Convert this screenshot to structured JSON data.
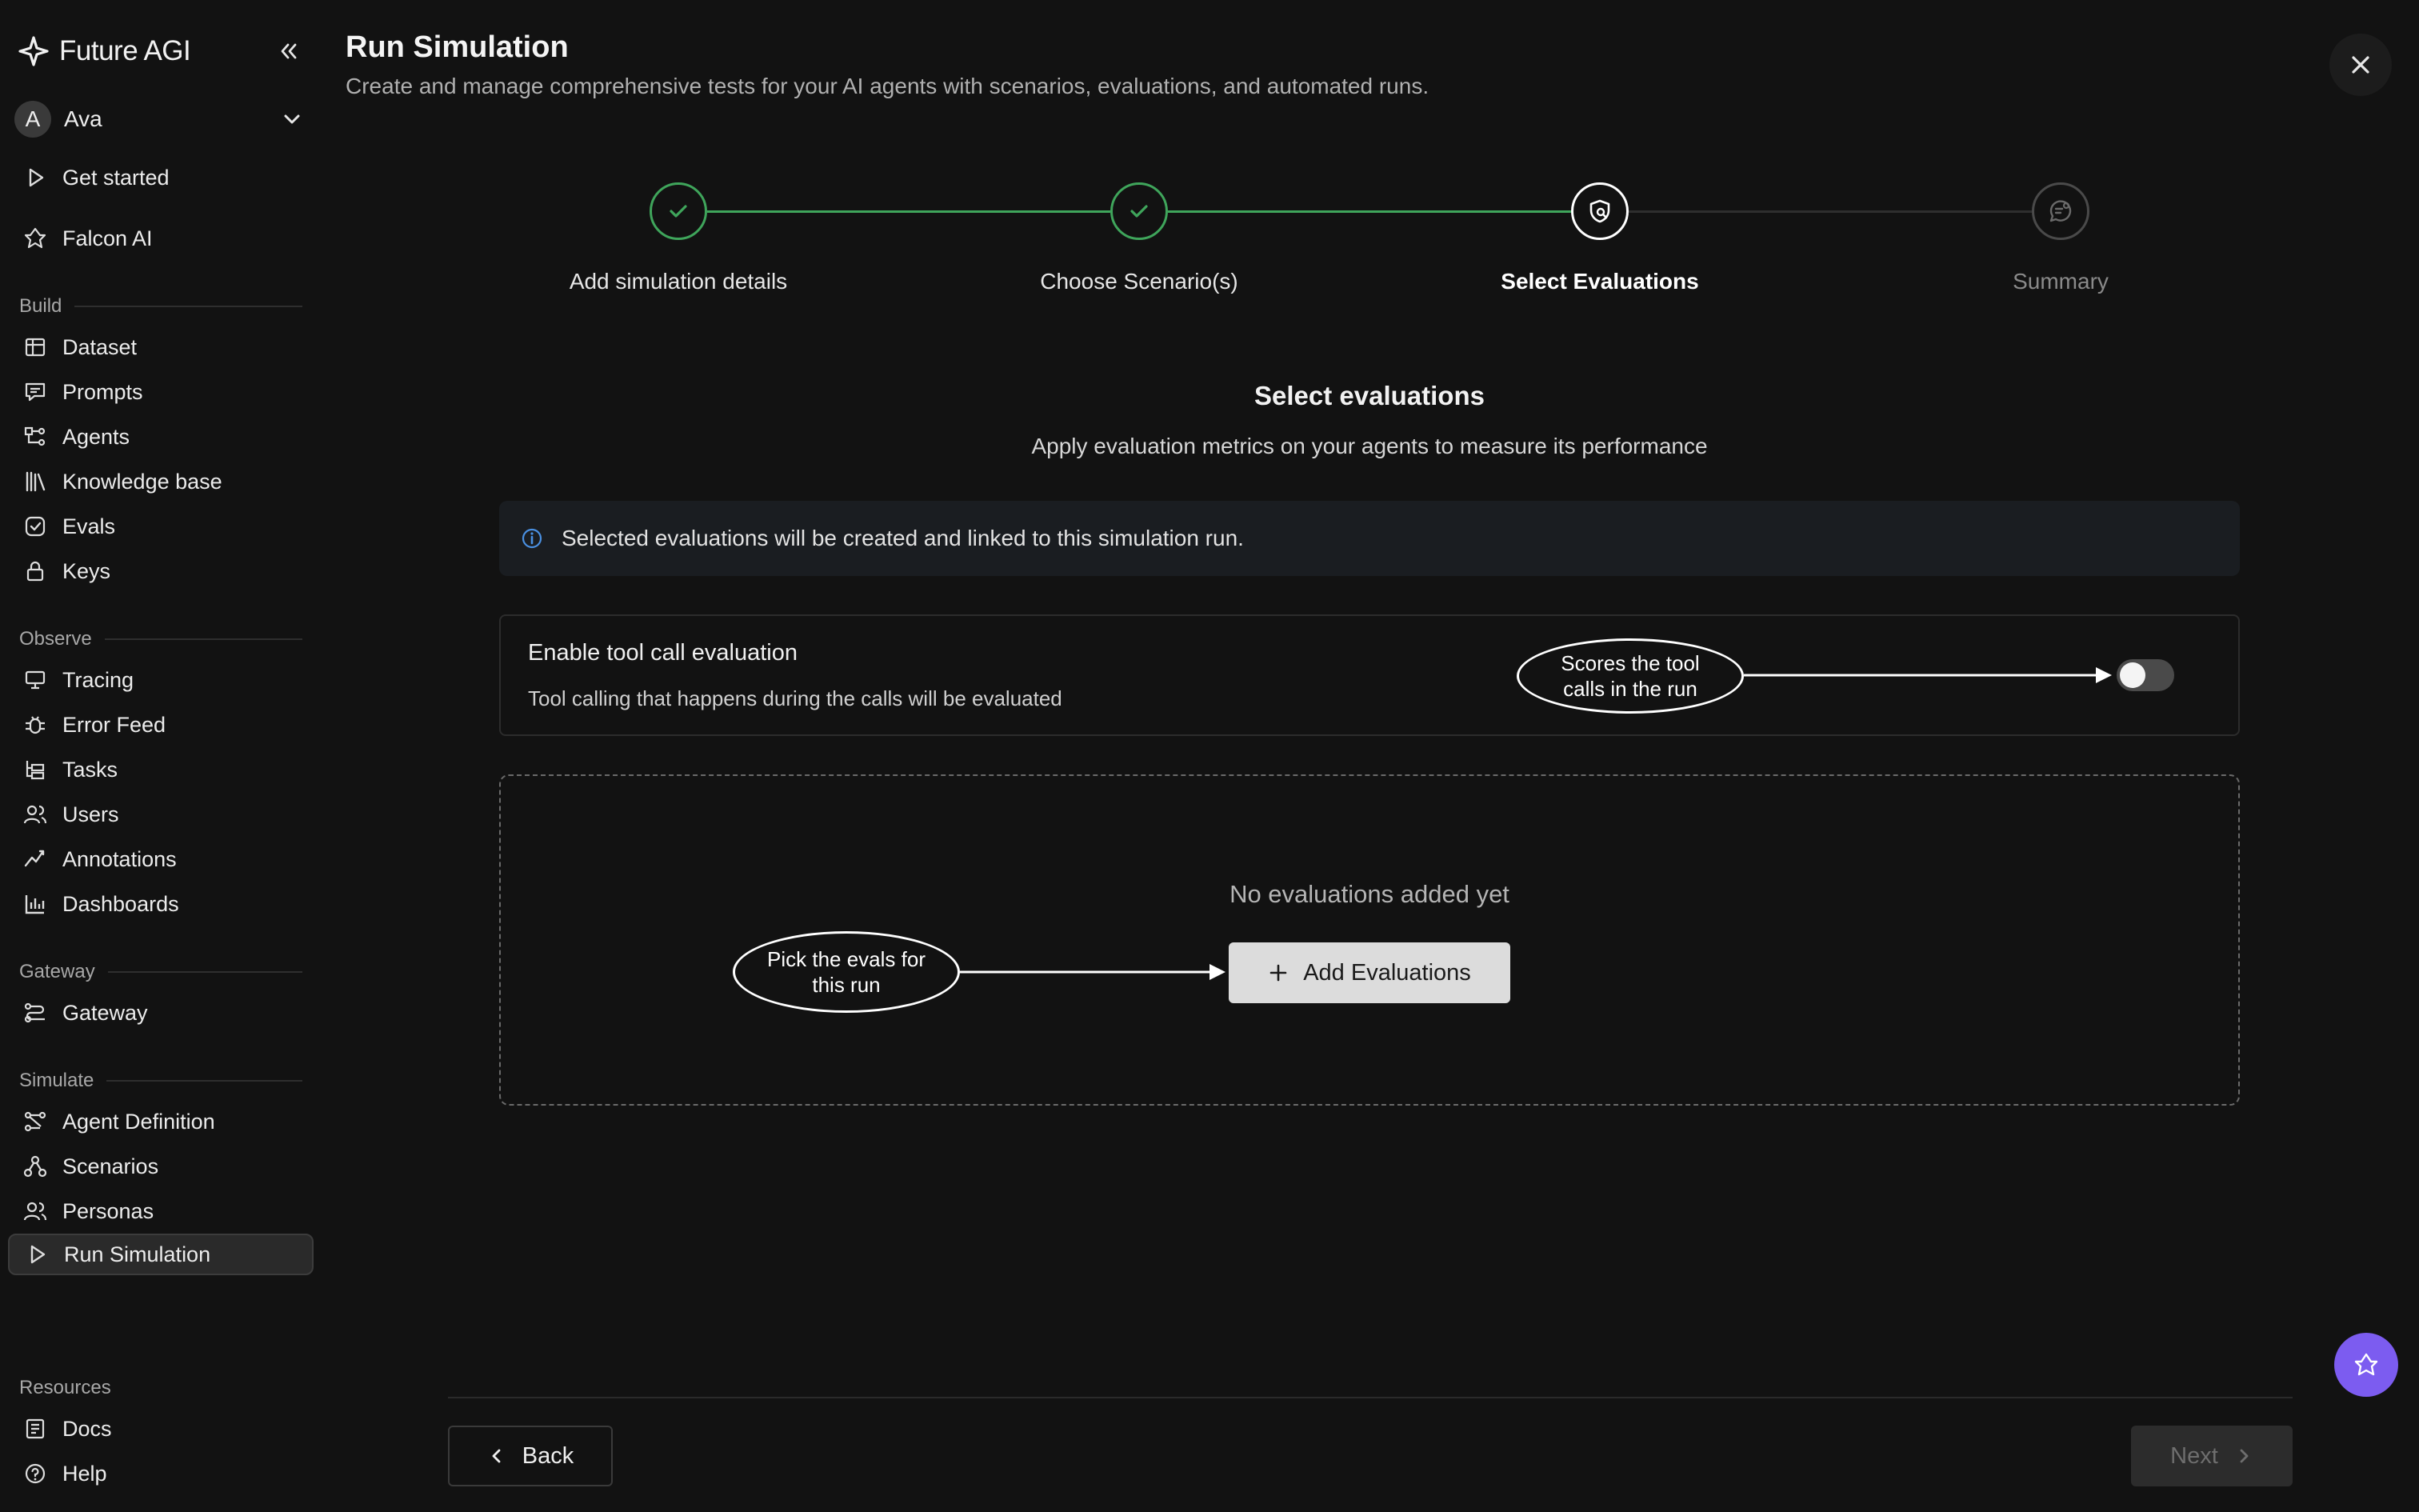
{
  "app": {
    "name": "Future AGI"
  },
  "user": {
    "initial": "A",
    "name": "Ava"
  },
  "sidebar": {
    "top_items": [
      {
        "label": "Get started",
        "icon": "play-icon"
      },
      {
        "label": "Falcon AI",
        "icon": "falcon-icon"
      }
    ],
    "sections": [
      {
        "label": "Build",
        "items": [
          {
            "label": "Dataset",
            "icon": "table-icon"
          },
          {
            "label": "Prompts",
            "icon": "prompt-icon"
          },
          {
            "label": "Agents",
            "icon": "agents-icon"
          },
          {
            "label": "Knowledge base",
            "icon": "library-icon"
          },
          {
            "label": "Evals",
            "icon": "check-circle-icon"
          },
          {
            "label": "Keys",
            "icon": "lock-icon"
          }
        ]
      },
      {
        "label": "Observe",
        "items": [
          {
            "label": "Tracing",
            "icon": "monitor-icon"
          },
          {
            "label": "Error Feed",
            "icon": "bug-icon"
          },
          {
            "label": "Tasks",
            "icon": "tasks-icon"
          },
          {
            "label": "Users",
            "icon": "users-icon"
          },
          {
            "label": "Annotations",
            "icon": "annotate-icon"
          },
          {
            "label": "Dashboards",
            "icon": "bar-chart-icon"
          }
        ]
      },
      {
        "label": "Gateway",
        "items": [
          {
            "label": "Gateway",
            "icon": "gateway-icon"
          }
        ]
      },
      {
        "label": "Simulate",
        "items": [
          {
            "label": "Agent Definition",
            "icon": "workflow-icon"
          },
          {
            "label": "Scenarios",
            "icon": "scenario-icon"
          },
          {
            "label": "Personas",
            "icon": "personas-icon"
          },
          {
            "label": "Run Simulation",
            "icon": "play-icon",
            "active": true
          }
        ]
      },
      {
        "label": "Resources",
        "items": [
          {
            "label": "Docs",
            "icon": "docs-icon"
          },
          {
            "label": "Help",
            "icon": "help-icon"
          }
        ]
      }
    ]
  },
  "header": {
    "title": "Run Simulation",
    "subtitle": "Create and manage comprehensive tests for your AI agents with scenarios, evaluations, and automated runs."
  },
  "stepper": {
    "steps": [
      {
        "label": "Add simulation details",
        "state": "done"
      },
      {
        "label": "Choose Scenario(s)",
        "state": "done"
      },
      {
        "label": "Select Evaluations",
        "state": "current"
      },
      {
        "label": "Summary",
        "state": "upcoming"
      }
    ],
    "colors": {
      "done": "#3fa55b",
      "current": "#ffffff",
      "upcoming": "#6a6a6a"
    }
  },
  "main": {
    "title": "Select evaluations",
    "description": "Apply evaluation metrics on your agents to measure its performance",
    "info_banner": "Selected evaluations will be created and linked to this simulation run.",
    "tool_call": {
      "title": "Enable tool call evaluation",
      "description": "Tool calling that happens during the calls will be evaluated",
      "enabled": false
    },
    "empty_state": "No evaluations added yet",
    "add_button": "Add Evaluations"
  },
  "callouts": {
    "toggle": "Scores the tool calls in the run",
    "add": "Pick the evals for this run"
  },
  "footer": {
    "back": "Back",
    "next": "Next"
  },
  "colors": {
    "accent": "#7c5cf0",
    "success": "#3fa55b",
    "info": "#4a90e2"
  }
}
